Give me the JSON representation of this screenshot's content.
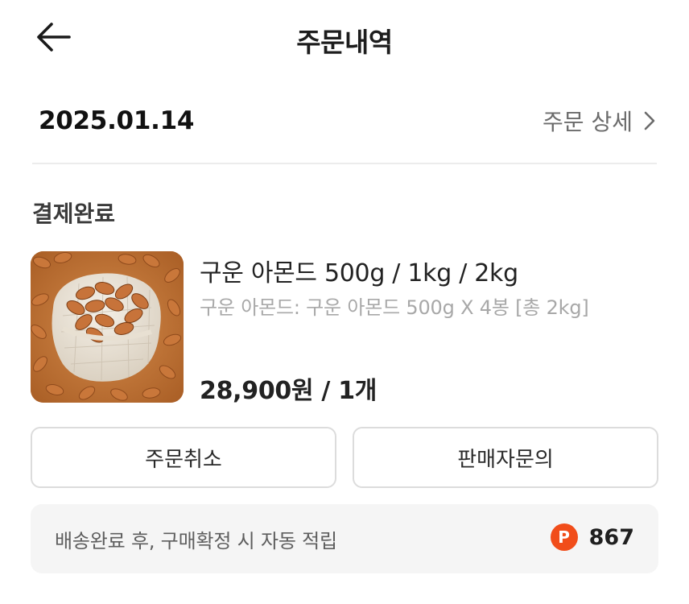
{
  "header": {
    "title": "주문내역",
    "back_icon": "arrow-left-icon"
  },
  "order": {
    "date": "2025.01.14",
    "detail_label": "주문 상세",
    "detail_icon": "chevron-right-icon"
  },
  "status": {
    "label": "결제완료"
  },
  "product": {
    "thumbnail": "almonds-in-burlap-sack",
    "name": "구운 아몬드 500g / 1kg / 2kg",
    "option": "구운 아몬드: 구운 아몬드 500g X 4봉 [총 2kg]",
    "price": "28,900원 / 1개"
  },
  "actions": {
    "cancel_label": "주문취소",
    "inquiry_label": "판매자문의"
  },
  "points": {
    "text": "배송완료 후, 구매확정 시 자동 적립",
    "badge_letter": "P",
    "value": "867",
    "badge_color": "#f14d1a"
  }
}
